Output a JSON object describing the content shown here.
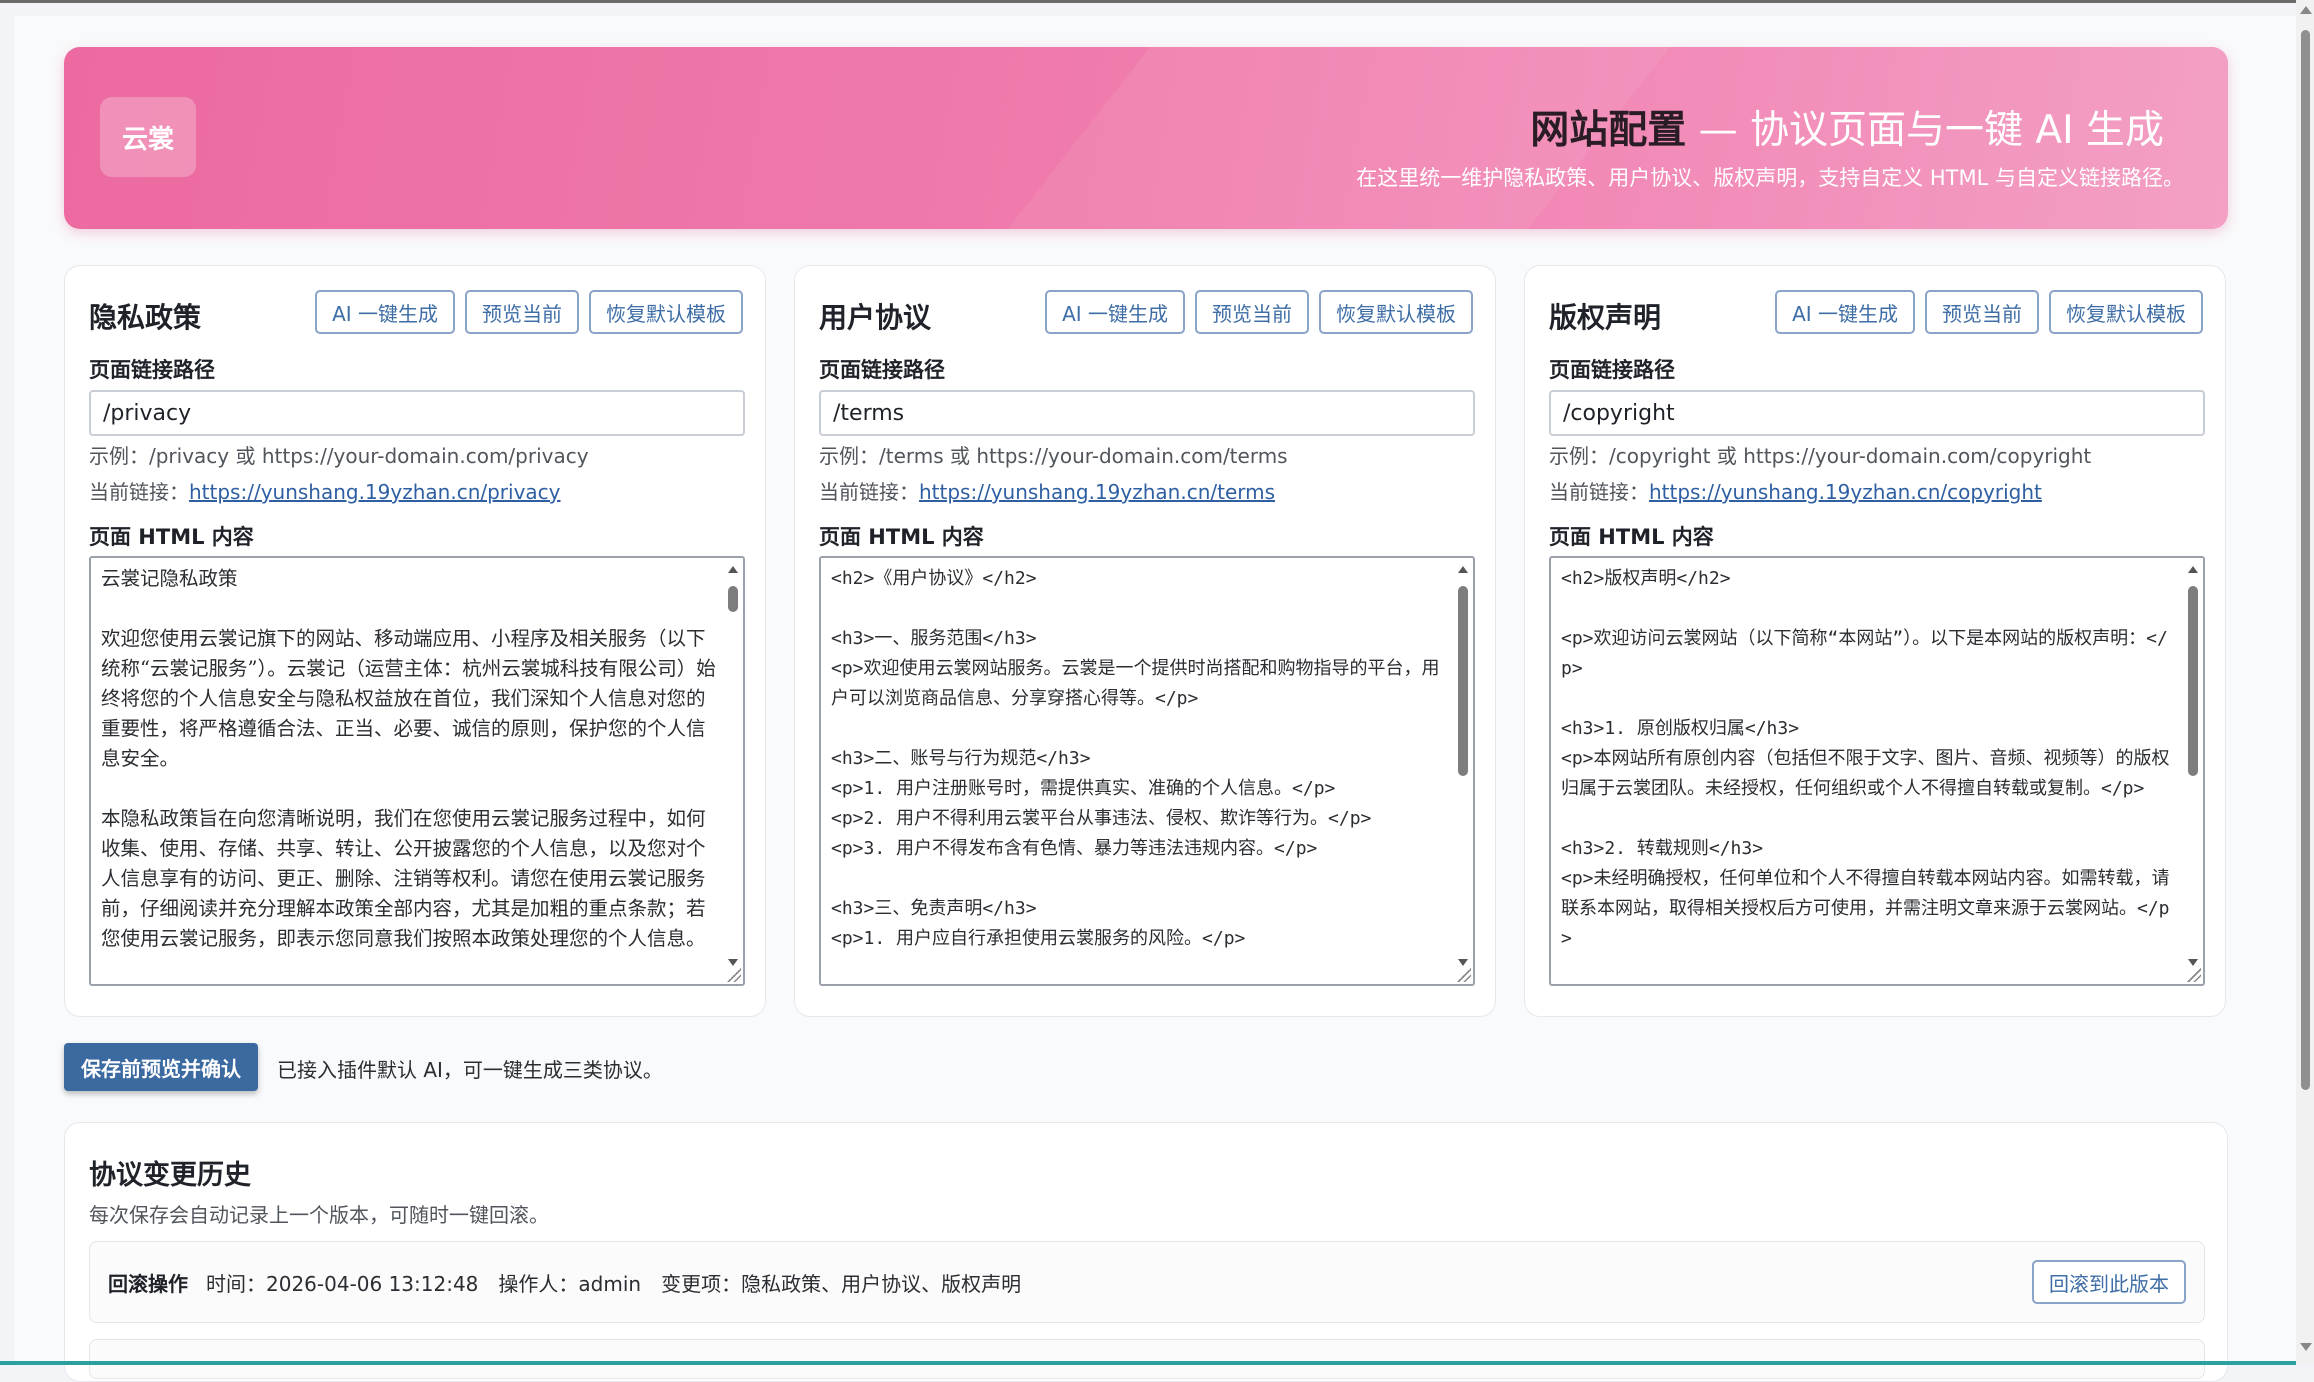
{
  "header": {
    "logo": "云裳",
    "title_bold": "网站配置",
    "title_rest": " — 协议页面与一键 AI 生成",
    "subtitle": "在这里统一维护隐私政策、用户协议、版权声明，支持自定义 HTML 与自定义链接路径。"
  },
  "common": {
    "btn_ai": "AI 一键生成",
    "btn_preview": "预览当前",
    "btn_reset": "恢复默认模板",
    "path_label": "页面链接路径",
    "html_label": "页面 HTML 内容",
    "current_prefix": "当前链接："
  },
  "privacy": {
    "title": "隐私政策",
    "path": "/privacy",
    "hint": "示例：/privacy 或 https://your-domain.com/privacy",
    "current_link": "https://yunshang.19yzhan.cn/privacy",
    "content": "云裳记隐私政策\n\n欢迎您使用云裳记旗下的网站、移动端应用、小程序及相关服务（以下统称“云裳记服务”）。云裳记（运营主体：杭州云裳城科技有限公司）始终将您的个人信息安全与隐私权益放在首位，我们深知个人信息对您的重要性，将严格遵循合法、正当、必要、诚信的原则，保护您的个人信息安全。\n\n本隐私政策旨在向您清晰说明，我们在您使用云裳记服务过程中，如何收集、使用、存储、共享、转让、公开披露您的个人信息，以及您对个人信息享有的访问、更正、删除、注销等权利。请您在使用云裳记服务前，仔细阅读并充分理解本政策全部内容，尤其是加粗的重点条款；若您使用云裳记服务，即表示您同意我们按照本政策处理您的个人信息。"
  },
  "terms": {
    "title": "用户协议",
    "path": "/terms",
    "hint": "示例：/terms 或 https://your-domain.com/terms",
    "current_link": "https://yunshang.19yzhan.cn/terms",
    "content": "<h2>《用户协议》</h2>\n\n<h3>一、服务范围</h3>\n<p>欢迎使用云裳网站服务。云裳是一个提供时尚搭配和购物指导的平台，用户可以浏览商品信息、分享穿搭心得等。</p>\n\n<h3>二、账号与行为规范</h3>\n<p>1. 用户注册账号时，需提供真实、准确的个人信息。</p>\n<p>2. 用户不得利用云裳平台从事违法、侵权、欺诈等行为。</p>\n<p>3. 用户不得发布含有色情、暴力等违法违规内容。</p>\n\n<h3>三、免责声明</h3>\n<p>1. 用户应自行承担使用云裳服务的风险。</p>"
  },
  "copyright": {
    "title": "版权声明",
    "path": "/copyright",
    "hint": "示例：/copyright 或 https://your-domain.com/copyright",
    "current_link": "https://yunshang.19yzhan.cn/copyright",
    "content": "<h2>版权声明</h2>\n\n<p>欢迎访问云裳网站（以下简称“本网站”）。以下是本网站的版权声明：</p>\n\n<h3>1. 原创版权归属</h3>\n<p>本网站所有原创内容（包括但不限于文字、图片、音频、视频等）的版权归属于云裳团队。未经授权，任何组织或个人不得擅自转载或复制。</p>\n\n<h3>2. 转载规则</h3>\n<p>未经明确授权，任何单位和个人不得擅自转载本网站内容。如需转载，请联系本网站，取得相关授权后方可使用，并需注明文章来源于云裳网站。</p>"
  },
  "actions": {
    "save_label": "保存前预览并确认",
    "save_note": "已接入插件默认 AI，可一键生成三类协议。"
  },
  "history": {
    "title": "协议变更历史",
    "desc": "每次保存会自动记录上一个版本，可随时一键回滚。",
    "rows": [
      {
        "action": "回滚操作",
        "time": "时间：2026-04-06 13:12:48",
        "operator": "操作人：admin",
        "changes": "变更项：隐私政策、用户协议、版权声明",
        "rollback_label": "回滚到此版本"
      }
    ]
  }
}
